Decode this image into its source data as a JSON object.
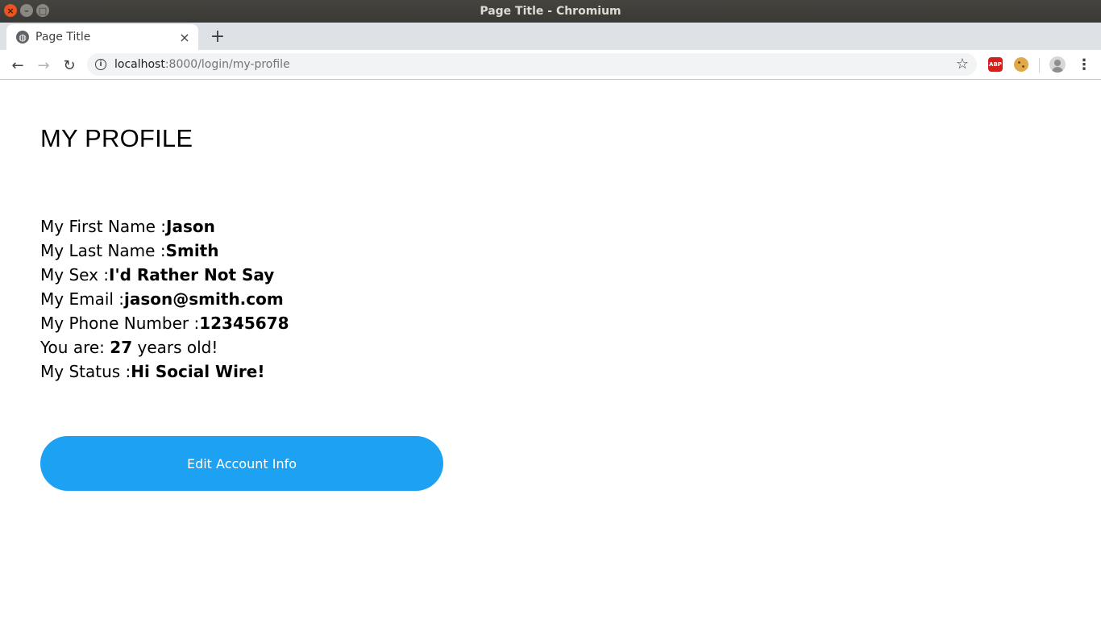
{
  "window": {
    "title": "Page Title - Chromium"
  },
  "tab": {
    "title": "Page Title",
    "close_glyph": "×",
    "new_tab_glyph": "+"
  },
  "toolbar": {
    "back_glyph": "←",
    "forward_glyph": "→",
    "reload_glyph": "↻",
    "url_host": "localhost",
    "url_rest": ":8000/login/my-profile",
    "extensions": [
      "adblock-plus-icon",
      "cookie-icon"
    ],
    "abp_label": "ABP"
  },
  "page": {
    "heading": "MY PROFILE",
    "fields": {
      "first_name": {
        "label": "My First Name :",
        "value": "Jason"
      },
      "last_name": {
        "label": "My Last Name :",
        "value": "Smith"
      },
      "sex": {
        "label": "My Sex :",
        "value": "I'd Rather Not Say"
      },
      "email": {
        "label": "My Email :",
        "value": "jason@smith.com"
      },
      "phone": {
        "label": "My Phone Number :",
        "value": "12345678"
      },
      "age": {
        "prefix": "You are: ",
        "value": "27",
        "suffix": " years old!"
      },
      "status": {
        "label": "My Status :",
        "value": "Hi Social Wire!"
      }
    },
    "edit_button_label": "Edit Account Info"
  },
  "colors": {
    "accent": "#1da1f2",
    "titlebar": "#3c3b37",
    "tabstrip": "#dee1e6"
  }
}
